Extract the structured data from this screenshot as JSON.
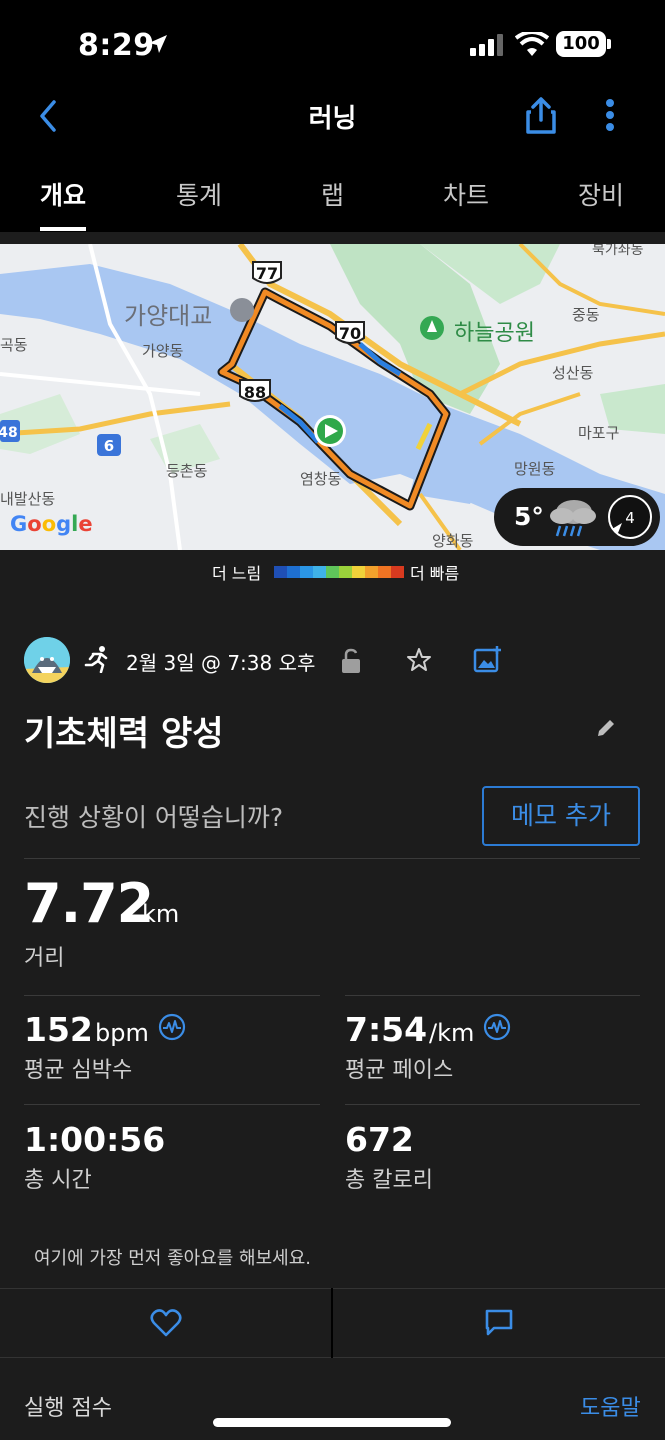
{
  "status_bar": {
    "time": "8:29",
    "battery": "100"
  },
  "header": {
    "title": "러닝"
  },
  "tabs": [
    {
      "label": "개요",
      "active": true
    },
    {
      "label": "통계",
      "active": false
    },
    {
      "label": "랩",
      "active": false
    },
    {
      "label": "차트",
      "active": false
    },
    {
      "label": "장비",
      "active": false
    }
  ],
  "map": {
    "labels": {
      "bridge": "가양대교",
      "gayang": "가양동",
      "park": "하늘공원",
      "jungdong": "중동",
      "seongsan": "성산동",
      "mapo": "마포구",
      "mangwon": "망원동",
      "deungchon": "등촌동",
      "yeomchang": "염창동",
      "naebalsan": "내발산동",
      "yanghwa": "양화동",
      "gokdong": "곡동",
      "top_right": "북가좌동",
      "google": "Google"
    },
    "route_shields": [
      "77",
      "70",
      "88",
      "6",
      "48"
    ],
    "weather": {
      "temp": "5°",
      "wind": "4"
    }
  },
  "legend": {
    "slow": "더 느림",
    "fast": "더 빠름",
    "colors": [
      "#1f4fb5",
      "#1e6fd1",
      "#2b96e6",
      "#3fb2e8",
      "#5fc55a",
      "#9ad23b",
      "#f0d23a",
      "#f2a12c",
      "#f07423",
      "#d83a1f"
    ]
  },
  "activity": {
    "date": "2월 3일 @ 7:38 오후",
    "title": "기초체력 양성",
    "prompt": "진행 상황이 어떻습니까?",
    "memo_button": "메모 추가",
    "distance": {
      "value": "7.72",
      "unit": "km",
      "label": "거리"
    },
    "heart_rate": {
      "value": "152",
      "unit": "bpm",
      "label": "평균 심박수"
    },
    "pace": {
      "value": "7:54",
      "unit": "/km",
      "label": "평균 페이스"
    },
    "time": {
      "value": "1:00:56",
      "label": "총 시간"
    },
    "calories": {
      "value": "672",
      "label": "총 칼로리"
    }
  },
  "likes": {
    "note": "여기에 가장 먼저 좋아요를 해보세요."
  },
  "score": {
    "label": "실행 점수",
    "help": "도움말"
  },
  "colors": {
    "accent": "#3b8de6",
    "background": "#1c1c1c"
  }
}
